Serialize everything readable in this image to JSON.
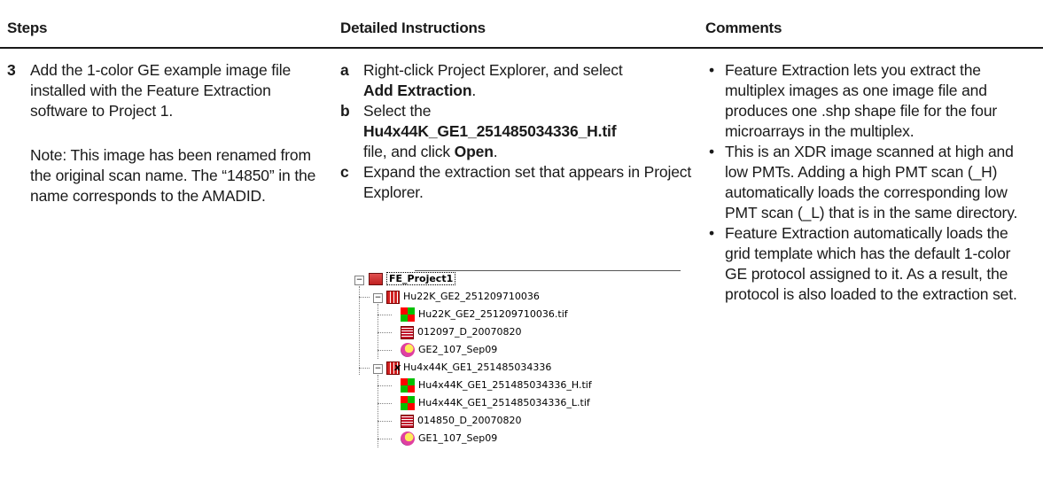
{
  "header": {
    "steps": "Steps",
    "instructions": "Detailed Instructions",
    "comments": "Comments"
  },
  "step": {
    "number": "3",
    "text": "Add the 1-color GE example image file installed with the Feature Extraction software to Project 1.",
    "note": "Note: This image has been renamed from the original scan name. The “14850” in the name corresponds to the AMADID."
  },
  "instructions": {
    "a_letter": "a",
    "a_text": "Right-click Project Explorer, and select",
    "a_bold": "Add Extraction",
    "a_end": ".",
    "b_letter": "b",
    "b_text": "Select the",
    "b_bold": "Hu4x44K_GE1_251485034336_H.tif",
    "b_mid": "file, and click",
    "b_bold2": "Open",
    "b_end": ".",
    "c_letter": "c",
    "c_text": "Expand the extraction set that appears in Project Explorer."
  },
  "comments": [
    "Feature Extraction lets you extract the multiplex images as one image file and produces one .shp shape file for the four microarrays in the multiplex.",
    "This is an XDR image scanned at high and low PMTs. Adding a high PMT scan (_H) automatically loads the corresponding low PMT scan (_L) that is in the same directory.",
    "Feature Extraction automatically loads the grid template which has the default 1-color GE protocol assigned to it. As a result, the protocol is also loaded to the extraction set."
  ],
  "bullet_glyph": "•",
  "tree": {
    "project": "FE_Project1",
    "set1": "Hu22K_GE2_251209710036",
    "set1_image": "Hu22K_GE2_251209710036.tif",
    "set1_grid": "012097_D_20070820",
    "set1_protocol": "GE2_107_Sep09",
    "set2": "Hu4x44K_GE1_251485034336",
    "set2_image_h": "Hu4x44K_GE1_251485034336_H.tif",
    "set2_image_l": "Hu4x44K_GE1_251485034336_L.tif",
    "set2_grid": "014850_D_20070820",
    "set2_protocol": "GE1_107_Sep09",
    "collapse_glyph": "−",
    "set2_icon_glyph": "x"
  }
}
